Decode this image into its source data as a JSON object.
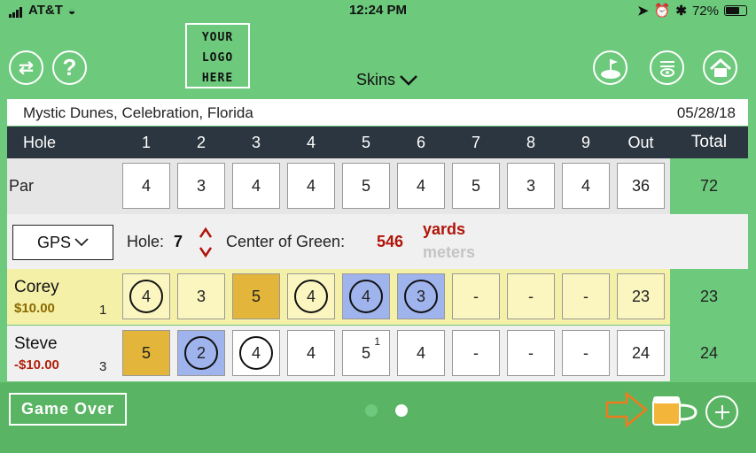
{
  "status_bar": {
    "carrier": "AT&T",
    "time": "12:24 PM",
    "battery": "72%",
    "battery_level": 0.72
  },
  "toolbar": {
    "logo_lines": [
      "YOUR",
      "LOGO",
      "HERE"
    ],
    "game_type": "Skins"
  },
  "course": {
    "name": "Mystic Dunes, Celebration, Florida",
    "date": "05/28/18"
  },
  "header": {
    "label": "Hole",
    "holes": [
      "1",
      "2",
      "3",
      "4",
      "5",
      "6",
      "7",
      "8",
      "9"
    ],
    "out": "Out",
    "total": "Total"
  },
  "par": {
    "label": "Par",
    "values": [
      "4",
      "3",
      "4",
      "4",
      "5",
      "4",
      "5",
      "3",
      "4"
    ],
    "out": "36",
    "total": "72"
  },
  "gps": {
    "button": "GPS",
    "hole_label": "Hole:",
    "hole": "7",
    "center_label": "Center of Green:",
    "distance": "546",
    "unit_active": "yards",
    "unit_inactive": "meters"
  },
  "players": [
    {
      "name": "Corey",
      "money": "$10.00",
      "rank": "1",
      "scores": [
        "4",
        "3",
        "5",
        "4",
        "4",
        "3",
        "-",
        "-",
        "-"
      ],
      "styles": [
        "circle",
        "plain",
        "gold",
        "circle",
        "blue-circle",
        "blue-circle",
        "empty",
        "empty",
        "empty"
      ],
      "marks": [
        "",
        "",
        "",
        "",
        "",
        "",
        "",
        "",
        ""
      ],
      "out": "23",
      "total": "23"
    },
    {
      "name": "Steve",
      "money": "-$10.00",
      "rank": "3",
      "scores": [
        "5",
        "2",
        "4",
        "4",
        "5",
        "4",
        "-",
        "-",
        "-"
      ],
      "styles": [
        "gold",
        "blue-circle",
        "circle",
        "plain",
        "plain",
        "plain",
        "empty",
        "empty",
        "empty"
      ],
      "marks": [
        "",
        "",
        "",
        "",
        "1",
        "",
        "",
        "",
        ""
      ],
      "out": "24",
      "total": "24"
    }
  ],
  "footer": {
    "game_over": "Game Over"
  },
  "colors": {
    "green": "#6dc97c",
    "gold": "#e3b53a",
    "blue": "#9fb3ec",
    "yellow_row": "#f5f0a8",
    "money_positive": "#8a6a00",
    "money_negative": "#b0200c",
    "distance_red": "#b0140a"
  }
}
